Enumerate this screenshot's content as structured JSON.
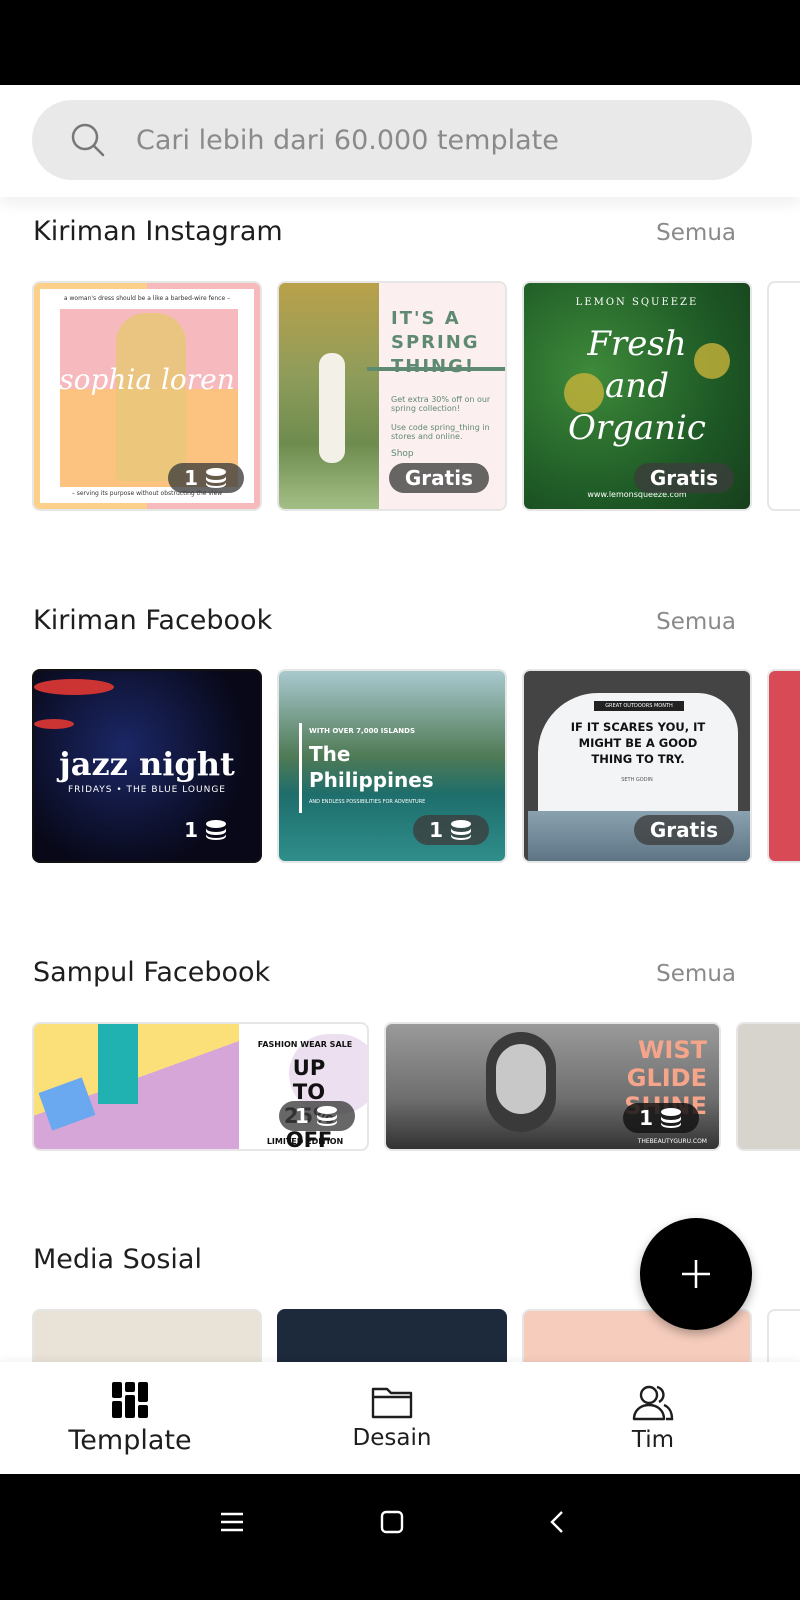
{
  "search": {
    "placeholder": "Cari lebih dari 60.000 template",
    "icon": "search-icon"
  },
  "see_all_label": "Semua",
  "sections": [
    {
      "title": "Kiriman Instagram",
      "cards": [
        {
          "badge": "1",
          "badge_type": "credit",
          "texts": [
            "a woman's dress should be a like a barbed-wire fence –",
            "sophia loren",
            "– serving its purpose without obstructing the view"
          ]
        },
        {
          "badge": "Gratis",
          "badge_type": "free",
          "texts": [
            "IT'S A SPRING THING!",
            "Get extra 30% off on our spring collection!",
            "Use code spring_thing in stores and online.",
            "Shop"
          ]
        },
        {
          "badge": "Gratis",
          "badge_type": "free",
          "texts": [
            "LEMON SQUEEZE",
            "Fresh and Organic",
            "www.lemonsqueeze.com"
          ]
        }
      ]
    },
    {
      "title": "Kiriman Facebook",
      "cards": [
        {
          "badge": "1",
          "badge_type": "credit",
          "texts": [
            "jazz night",
            "FRIDAYS • THE BLUE LOUNGE"
          ]
        },
        {
          "badge": "1",
          "badge_type": "credit",
          "texts": [
            "WITH OVER 7,000 ISLANDS",
            "The Philippines",
            "AND ENDLESS POSSIBILITIES FOR ADVENTURE"
          ]
        },
        {
          "badge": "Gratis",
          "badge_type": "free",
          "texts": [
            "GREAT OUTDOORS MONTH",
            "IF IT SCARES YOU, IT MIGHT BE A GOOD THING TO TRY.",
            "SETH GODIN"
          ]
        }
      ]
    },
    {
      "title": "Sampul Facebook",
      "cards": [
        {
          "badge": "1",
          "badge_type": "credit",
          "texts": [
            "FASHION WEAR SALE",
            "UP TO 25% OFF",
            "LIMITED EDITION"
          ]
        },
        {
          "badge": "1",
          "badge_type": "credit",
          "texts": [
            "WIST GLIDE SHINE",
            "THEBEAUTYGURU.COM"
          ]
        }
      ]
    },
    {
      "title": "Media Sosial",
      "cards": []
    }
  ],
  "fab": {
    "icon": "plus-icon"
  },
  "bottom_nav": [
    {
      "label": "Template",
      "icon": "template-grid-icon",
      "active": true
    },
    {
      "label": "Desain",
      "icon": "folder-icon",
      "active": false
    },
    {
      "label": "Tim",
      "icon": "team-icon",
      "active": false
    }
  ]
}
